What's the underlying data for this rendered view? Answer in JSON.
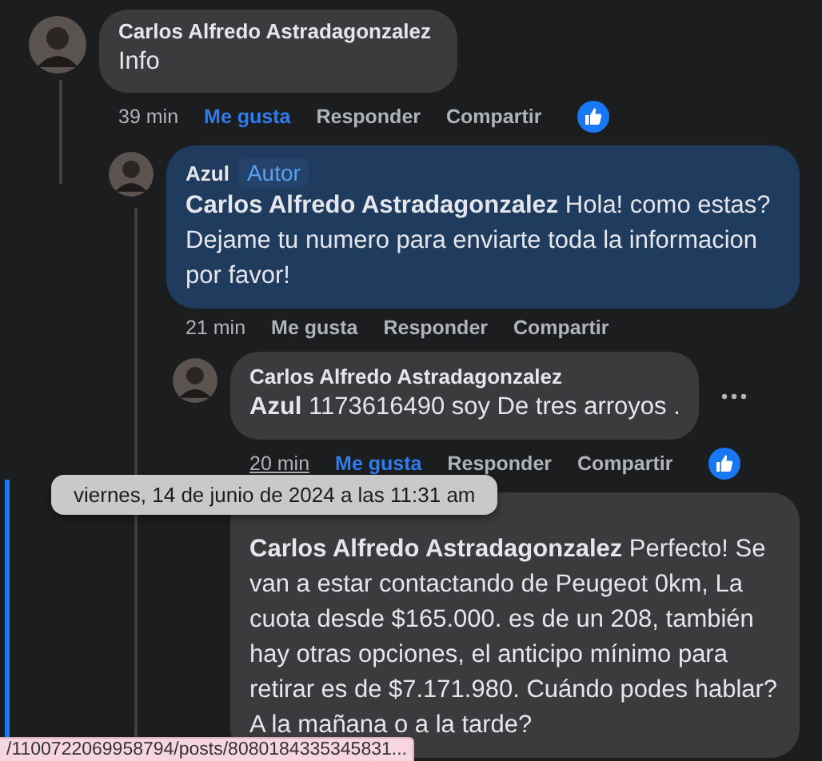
{
  "comments": [
    {
      "author": "Carlos Alfredo Astradagonzalez",
      "text": "Info",
      "highlighted": false,
      "time": "39 min",
      "liked": true,
      "hovered": false,
      "has_reaction": true,
      "actions": [
        "Me gusta",
        "Responder",
        "Compartir"
      ]
    },
    {
      "author": "Azul",
      "badge": "Autor",
      "text": "**Carlos Alfredo Astradagonzalez** Hola! como estas? Dejame tu numero para enviarte toda la informacion por favor!",
      "highlighted": true,
      "time": "21 min",
      "liked": false,
      "hovered": false,
      "has_reaction": false,
      "actions": [
        "Me gusta",
        "Responder",
        "Compartir"
      ]
    },
    {
      "author": "Carlos Alfredo Astradagonzalez",
      "text": "**Azul** 1173616490 soy De tres arroyos .",
      "highlighted": false,
      "time": "20 min",
      "liked": true,
      "hovered": true,
      "has_reaction": true,
      "actions": [
        "Me gusta",
        "Responder",
        "Compartir"
      ]
    },
    {
      "text": "**Carlos Alfredo Astradagonzalez** Perfecto! Se van a estar contactando de Peugeot 0km, La cuota desde $165.000. es de un 208, también hay otras opciones, el anticipo mínimo para retirar es de $7.171.980. Cuándo podes hablar? A la mañana o a la tarde?",
      "highlighted": false
    }
  ],
  "tooltip": "viernes, 14 de junio de 2024 a las 11:31 am",
  "status_url": "/1100722069958794/posts/8080184335345831..."
}
